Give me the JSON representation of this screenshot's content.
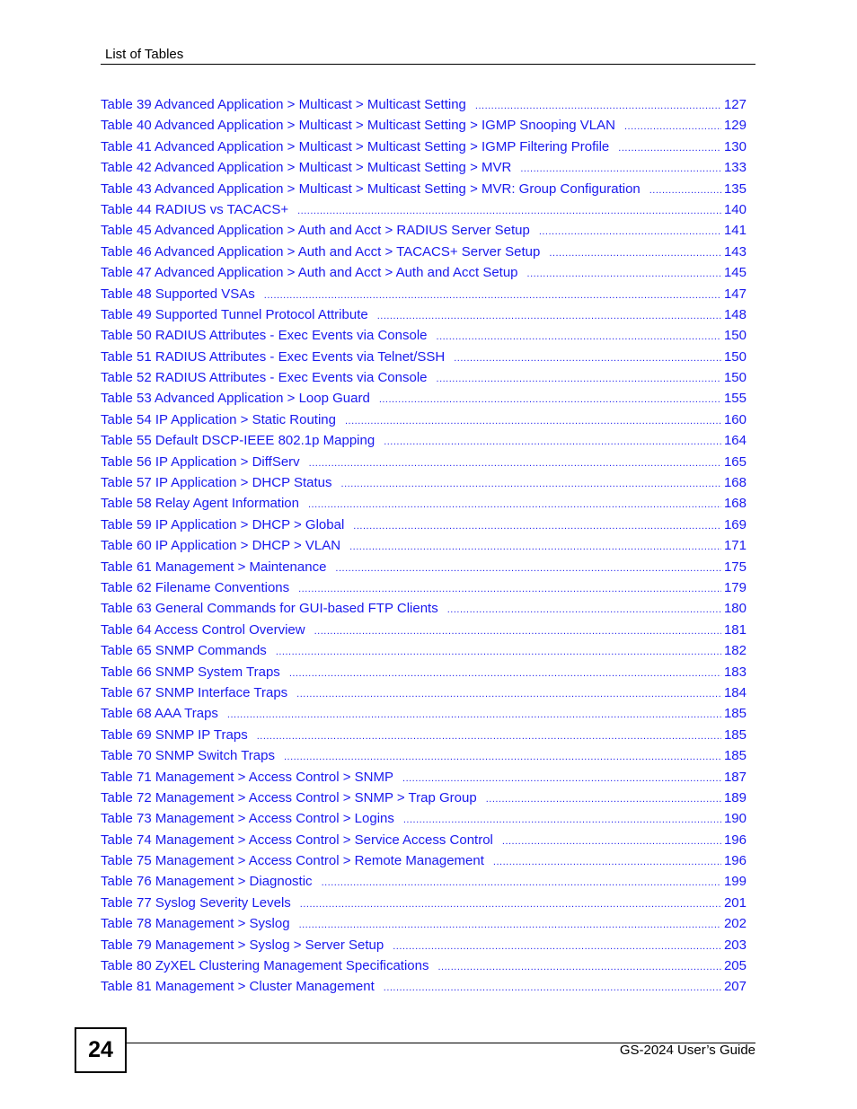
{
  "header": {
    "title": "List of Tables"
  },
  "toc": [
    {
      "label": "Table 39 Advanced Application > Multicast > Multicast Setting",
      "page": "127"
    },
    {
      "label": "Table 40 Advanced Application > Multicast > Multicast Setting > IGMP Snooping VLAN",
      "page": "129"
    },
    {
      "label": "Table 41 Advanced Application > Multicast > Multicast Setting > IGMP Filtering Profile",
      "page": "130"
    },
    {
      "label": "Table 42 Advanced Application > Multicast > Multicast Setting > MVR",
      "page": "133"
    },
    {
      "label": "Table 43 Advanced Application > Multicast > Multicast Setting > MVR: Group Configuration",
      "page": "135"
    },
    {
      "label": "Table 44 RADIUS vs TACACS+",
      "page": "140"
    },
    {
      "label": "Table 45 Advanced Application > Auth and Acct > RADIUS Server Setup",
      "page": "141"
    },
    {
      "label": "Table 46 Advanced Application > Auth and Acct > TACACS+ Server Setup",
      "page": "143"
    },
    {
      "label": "Table 47 Advanced Application > Auth and Acct > Auth and Acct Setup",
      "page": "145"
    },
    {
      "label": "Table 48 Supported VSAs",
      "page": "147"
    },
    {
      "label": "Table 49 Supported Tunnel Protocol Attribute",
      "page": "148"
    },
    {
      "label": "Table 50 RADIUS Attributes - Exec Events via Console",
      "page": "150"
    },
    {
      "label": "Table 51 RADIUS Attributes - Exec Events via Telnet/SSH",
      "page": "150"
    },
    {
      "label": "Table 52 RADIUS Attributes - Exec Events via Console",
      "page": "150"
    },
    {
      "label": "Table 53 Advanced Application > Loop Guard",
      "page": "155"
    },
    {
      "label": "Table 54 IP Application > Static Routing",
      "page": "160"
    },
    {
      "label": "Table 55 Default DSCP-IEEE 802.1p Mapping",
      "page": "164"
    },
    {
      "label": "Table 56 IP Application > DiffServ",
      "page": "165"
    },
    {
      "label": "Table 57 IP Application > DHCP Status",
      "page": "168"
    },
    {
      "label": "Table 58 Relay Agent Information",
      "page": "168"
    },
    {
      "label": "Table 59 IP Application > DHCP > Global",
      "page": "169"
    },
    {
      "label": "Table 60 IP Application > DHCP > VLAN",
      "page": "171"
    },
    {
      "label": "Table 61 Management > Maintenance",
      "page": "175"
    },
    {
      "label": "Table 62 Filename Conventions",
      "page": "179"
    },
    {
      "label": "Table 63 General Commands for GUI-based FTP Clients",
      "page": "180"
    },
    {
      "label": "Table 64 Access Control Overview",
      "page": "181"
    },
    {
      "label": "Table 65 SNMP Commands",
      "page": "182"
    },
    {
      "label": "Table 66 SNMP System Traps",
      "page": "183"
    },
    {
      "label": "Table 67 SNMP Interface Traps",
      "page": "184"
    },
    {
      "label": "Table 68 AAA Traps",
      "page": "185"
    },
    {
      "label": "Table 69 SNMP IP Traps",
      "page": "185"
    },
    {
      "label": "Table 70 SNMP Switch Traps",
      "page": "185"
    },
    {
      "label": "Table 71 Management > Access Control > SNMP",
      "page": "187"
    },
    {
      "label": "Table 72 Management > Access Control > SNMP > Trap Group",
      "page": "189"
    },
    {
      "label": "Table 73 Management > Access Control > Logins",
      "page": "190"
    },
    {
      "label": "Table 74 Management > Access Control > Service Access Control",
      "page": "196"
    },
    {
      "label": "Table 75 Management > Access Control > Remote Management",
      "page": "196"
    },
    {
      "label": "Table 76 Management > Diagnostic",
      "page": "199"
    },
    {
      "label": "Table 77 Syslog Severity Levels",
      "page": "201"
    },
    {
      "label": "Table 78 Management > Syslog",
      "page": "202"
    },
    {
      "label": "Table 79 Management > Syslog > Server Setup",
      "page": "203"
    },
    {
      "label": "Table 80 ZyXEL Clustering Management Specifications",
      "page": "205"
    },
    {
      "label": "Table 81 Management > Cluster Management",
      "page": "207"
    }
  ],
  "footer": {
    "page_number": "24",
    "guide_title": "GS-2024 User’s Guide"
  },
  "colors": {
    "link": "#1a1aee",
    "text": "#000000"
  }
}
